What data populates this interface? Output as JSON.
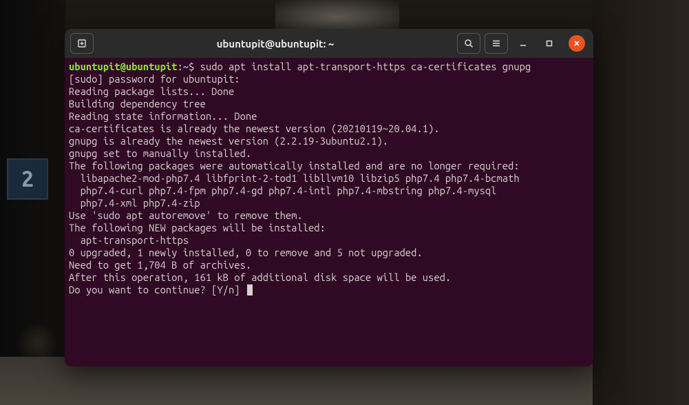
{
  "window": {
    "title": "ubuntupit@ubuntupit: ~"
  },
  "prompt": {
    "user_host": "ubuntupit@ubuntupit",
    "colon": ":",
    "path": "~",
    "dollar": "$",
    "command": " sudo apt install apt-transport-https ca-certificates gnupg"
  },
  "lines": {
    "l1": "[sudo] password for ubuntupit:",
    "l2": "Reading package lists... Done",
    "l3": "Building dependency tree",
    "l4": "Reading state information... Done",
    "l5": "ca-certificates is already the newest version (20210119~20.04.1).",
    "l6": "gnupg is already the newest version (2.2.19-3ubuntu2.1).",
    "l7": "gnupg set to manually installed.",
    "l8": "The following packages were automatically installed and are no longer required:",
    "l9": "  libapache2-mod-php7.4 libfprint-2-tod1 libllvm10 libzip5 php7.4 php7.4-bcmath",
    "l10": "  php7.4-curl php7.4-fpm php7.4-gd php7.4-intl php7.4-mbstring php7.4-mysql",
    "l11": "  php7.4-xml php7.4-zip",
    "l12": "Use 'sudo apt autoremove' to remove them.",
    "l13": "The following NEW packages will be installed:",
    "l14": "  apt-transport-https",
    "l15": "0 upgraded, 1 newly installed, 0 to remove and 5 not upgraded.",
    "l16": "Need to get 1,704 B of archives.",
    "l17": "After this operation, 161 kB of additional disk space will be used.",
    "l18": "Do you want to continue? [Y/n] "
  },
  "bg": {
    "sign": "2"
  }
}
